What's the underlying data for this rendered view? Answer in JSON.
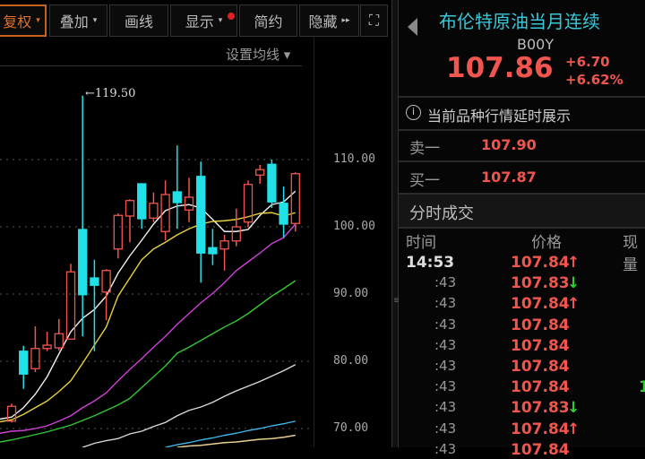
{
  "toolbar": {
    "items": [
      {
        "label": "复权",
        "caret": "▾"
      },
      {
        "label": "叠加",
        "caret": "▾"
      },
      {
        "label": "画线"
      },
      {
        "label": "显示",
        "caret": "▾"
      },
      {
        "label": "简约"
      },
      {
        "label": "隐藏",
        "caret": "▸▸"
      }
    ],
    "fullscreen_icon": "⛶"
  },
  "chart": {
    "ma_setting": "设置均线 ▾",
    "max_label": "←119.50",
    "y_ticks": [
      "110.00",
      "100.00",
      "90.00",
      "80.00",
      "70.00"
    ]
  },
  "chart_data": {
    "type": "candlestick",
    "y_ticks": [
      110,
      100,
      90,
      80,
      70
    ],
    "ylim": [
      66.5,
      123
    ],
    "annotation": {
      "label": "119.50",
      "candle": 7
    },
    "candles": [
      [
        71.1,
        73.3,
        73.7,
        70.9
      ],
      [
        81.5,
        78.1,
        82.3,
        75.9
      ],
      [
        78.9,
        81.9,
        85.2,
        78.4
      ],
      [
        81.9,
        82.4,
        84.4,
        81.5
      ],
      [
        82.0,
        84.1,
        86.3,
        81.6
      ],
      [
        83.3,
        93.3,
        94.5,
        83.3
      ],
      [
        99.6,
        89.9,
        119.5,
        83.7
      ],
      [
        92.4,
        91.3,
        95.1,
        81.5
      ],
      [
        90.3,
        93.5,
        93.7,
        86.1
      ],
      [
        96.7,
        101.7,
        102.0,
        95.3
      ],
      [
        101.6,
        103.9,
        104.1,
        97.7
      ],
      [
        106.4,
        101.2,
        106.4,
        99.7
      ],
      [
        101.3,
        103.5,
        105.1,
        100.7
      ],
      [
        99.3,
        104.8,
        106.9,
        98.0
      ],
      [
        105.2,
        103.6,
        112.1,
        99.7
      ],
      [
        102.5,
        104.4,
        107.3,
        100.7
      ],
      [
        107.5,
        96.1,
        109.7,
        91.7
      ],
      [
        96.9,
        96.0,
        99.7,
        94.3
      ],
      [
        96.7,
        97.9,
        98.8,
        93.5
      ],
      [
        97.9,
        100.0,
        102.7,
        97.1
      ],
      [
        100.7,
        106.3,
        106.9,
        99.9
      ],
      [
        107.7,
        108.5,
        109.2,
        106.4
      ],
      [
        109.3,
        103.7,
        110.0,
        102.8
      ],
      [
        103.5,
        100.4,
        106.0,
        98.4
      ],
      [
        100.5,
        107.9,
        108.1,
        99.3
      ]
    ],
    "ma": [
      {
        "name": "MA5",
        "color": "#f0f0f0",
        "values": [
          71.7,
          73.1,
          75.1,
          77.7,
          81.1,
          84.4,
          86.4,
          87.7,
          89.7,
          93.1,
          95.7,
          98.0,
          100.4,
          102.4,
          103.1,
          103.3,
          102.8,
          101.1,
          99.3,
          99.3,
          99.6,
          101.7,
          103.3,
          103.7,
          105.3
        ]
      },
      {
        "name": "MA10",
        "color": "#e8d040",
        "values": [
          71.3,
          72.1,
          73.1,
          74.1,
          75.5,
          77.1,
          79.7,
          82.4,
          85.1,
          89.7,
          92.4,
          95.1,
          96.7,
          97.7,
          98.8,
          99.7,
          100.4,
          100.8,
          100.9,
          101.1,
          101.5,
          102.0,
          102.1,
          101.6,
          102.1
        ]
      },
      {
        "name": "MA20",
        "color": "#d040d8",
        "values": [
          69.6,
          69.7,
          70.0,
          70.4,
          71.1,
          71.9,
          73.1,
          74.1,
          75.3,
          77.1,
          78.8,
          80.4,
          82.1,
          83.7,
          85.5,
          87.1,
          88.7,
          90.1,
          91.7,
          93.5,
          94.8,
          96.1,
          97.5,
          98.4,
          100.4
        ]
      },
      {
        "name": "MA30",
        "color": "#30c830",
        "values": [
          68.3,
          68.7,
          69.1,
          69.5,
          70.0,
          70.5,
          71.2,
          71.9,
          72.7,
          73.5,
          74.5,
          76.1,
          77.7,
          79.3,
          81.2,
          82.1,
          83.1,
          84.1,
          85.1,
          86.0,
          87.1,
          88.4,
          89.7,
          90.8,
          92.0
        ]
      },
      {
        "name": "MA60",
        "color": "#d8d8d8",
        "values": [
          null,
          null,
          null,
          null,
          null,
          null,
          67.2,
          67.8,
          68.2,
          68.5,
          69.2,
          69.6,
          70.3,
          70.9,
          71.9,
          72.7,
          73.2,
          73.9,
          74.8,
          75.6,
          76.3,
          77.0,
          77.8,
          78.6,
          79.5
        ]
      },
      {
        "name": "MA120",
        "color": "#40b8f0",
        "values": [
          null,
          null,
          null,
          null,
          null,
          null,
          null,
          null,
          null,
          null,
          null,
          null,
          null,
          67.2,
          67.6,
          67.9,
          68.3,
          68.6,
          69.0,
          69.3,
          69.7,
          70.0,
          70.4,
          70.7,
          71.1
        ]
      },
      {
        "name": "MA250",
        "color": "#e8d090",
        "values": [
          null,
          null,
          null,
          null,
          null,
          null,
          null,
          null,
          null,
          null,
          null,
          null,
          null,
          null,
          67.2,
          67.4,
          67.5,
          67.7,
          67.9,
          68.0,
          68.2,
          68.4,
          68.5,
          68.7,
          69.0
        ]
      }
    ]
  },
  "quote": {
    "title": "布伦特原油当月连续",
    "code": "B00Y",
    "price": "107.86",
    "change": "+6.70",
    "change_pct": "+6.62%",
    "notice": "当前品种行情延时展示",
    "ask_label": "卖一",
    "ask": "107.90",
    "bid_label": "买一",
    "bid": "107.87"
  },
  "trades": {
    "title": "分时成交",
    "headers": [
      "时间",
      "价格",
      "现量"
    ],
    "rows": [
      {
        "time": "14:53",
        "price": "107.84",
        "dir": "up"
      },
      {
        "time": ":43",
        "price": "107.83",
        "dir": "down"
      },
      {
        "time": ":43",
        "price": "107.84",
        "dir": "up"
      },
      {
        "time": ":43",
        "price": "107.84",
        "dir": ""
      },
      {
        "time": ":43",
        "price": "107.84",
        "dir": ""
      },
      {
        "time": ":43",
        "price": "107.84",
        "dir": ""
      },
      {
        "time": ":43",
        "price": "107.84",
        "dir": "",
        "vol": "1"
      },
      {
        "time": ":43",
        "price": "107.83",
        "dir": "down"
      },
      {
        "time": ":43",
        "price": "107.84",
        "dir": "up"
      },
      {
        "time": ":43",
        "price": "107.84",
        "dir": ""
      }
    ]
  },
  "colors": {
    "up": "#f0564e",
    "down": "#20e0e8",
    "title": "#38c8d8",
    "accent": "#c8601e",
    "green": "#30d030"
  }
}
